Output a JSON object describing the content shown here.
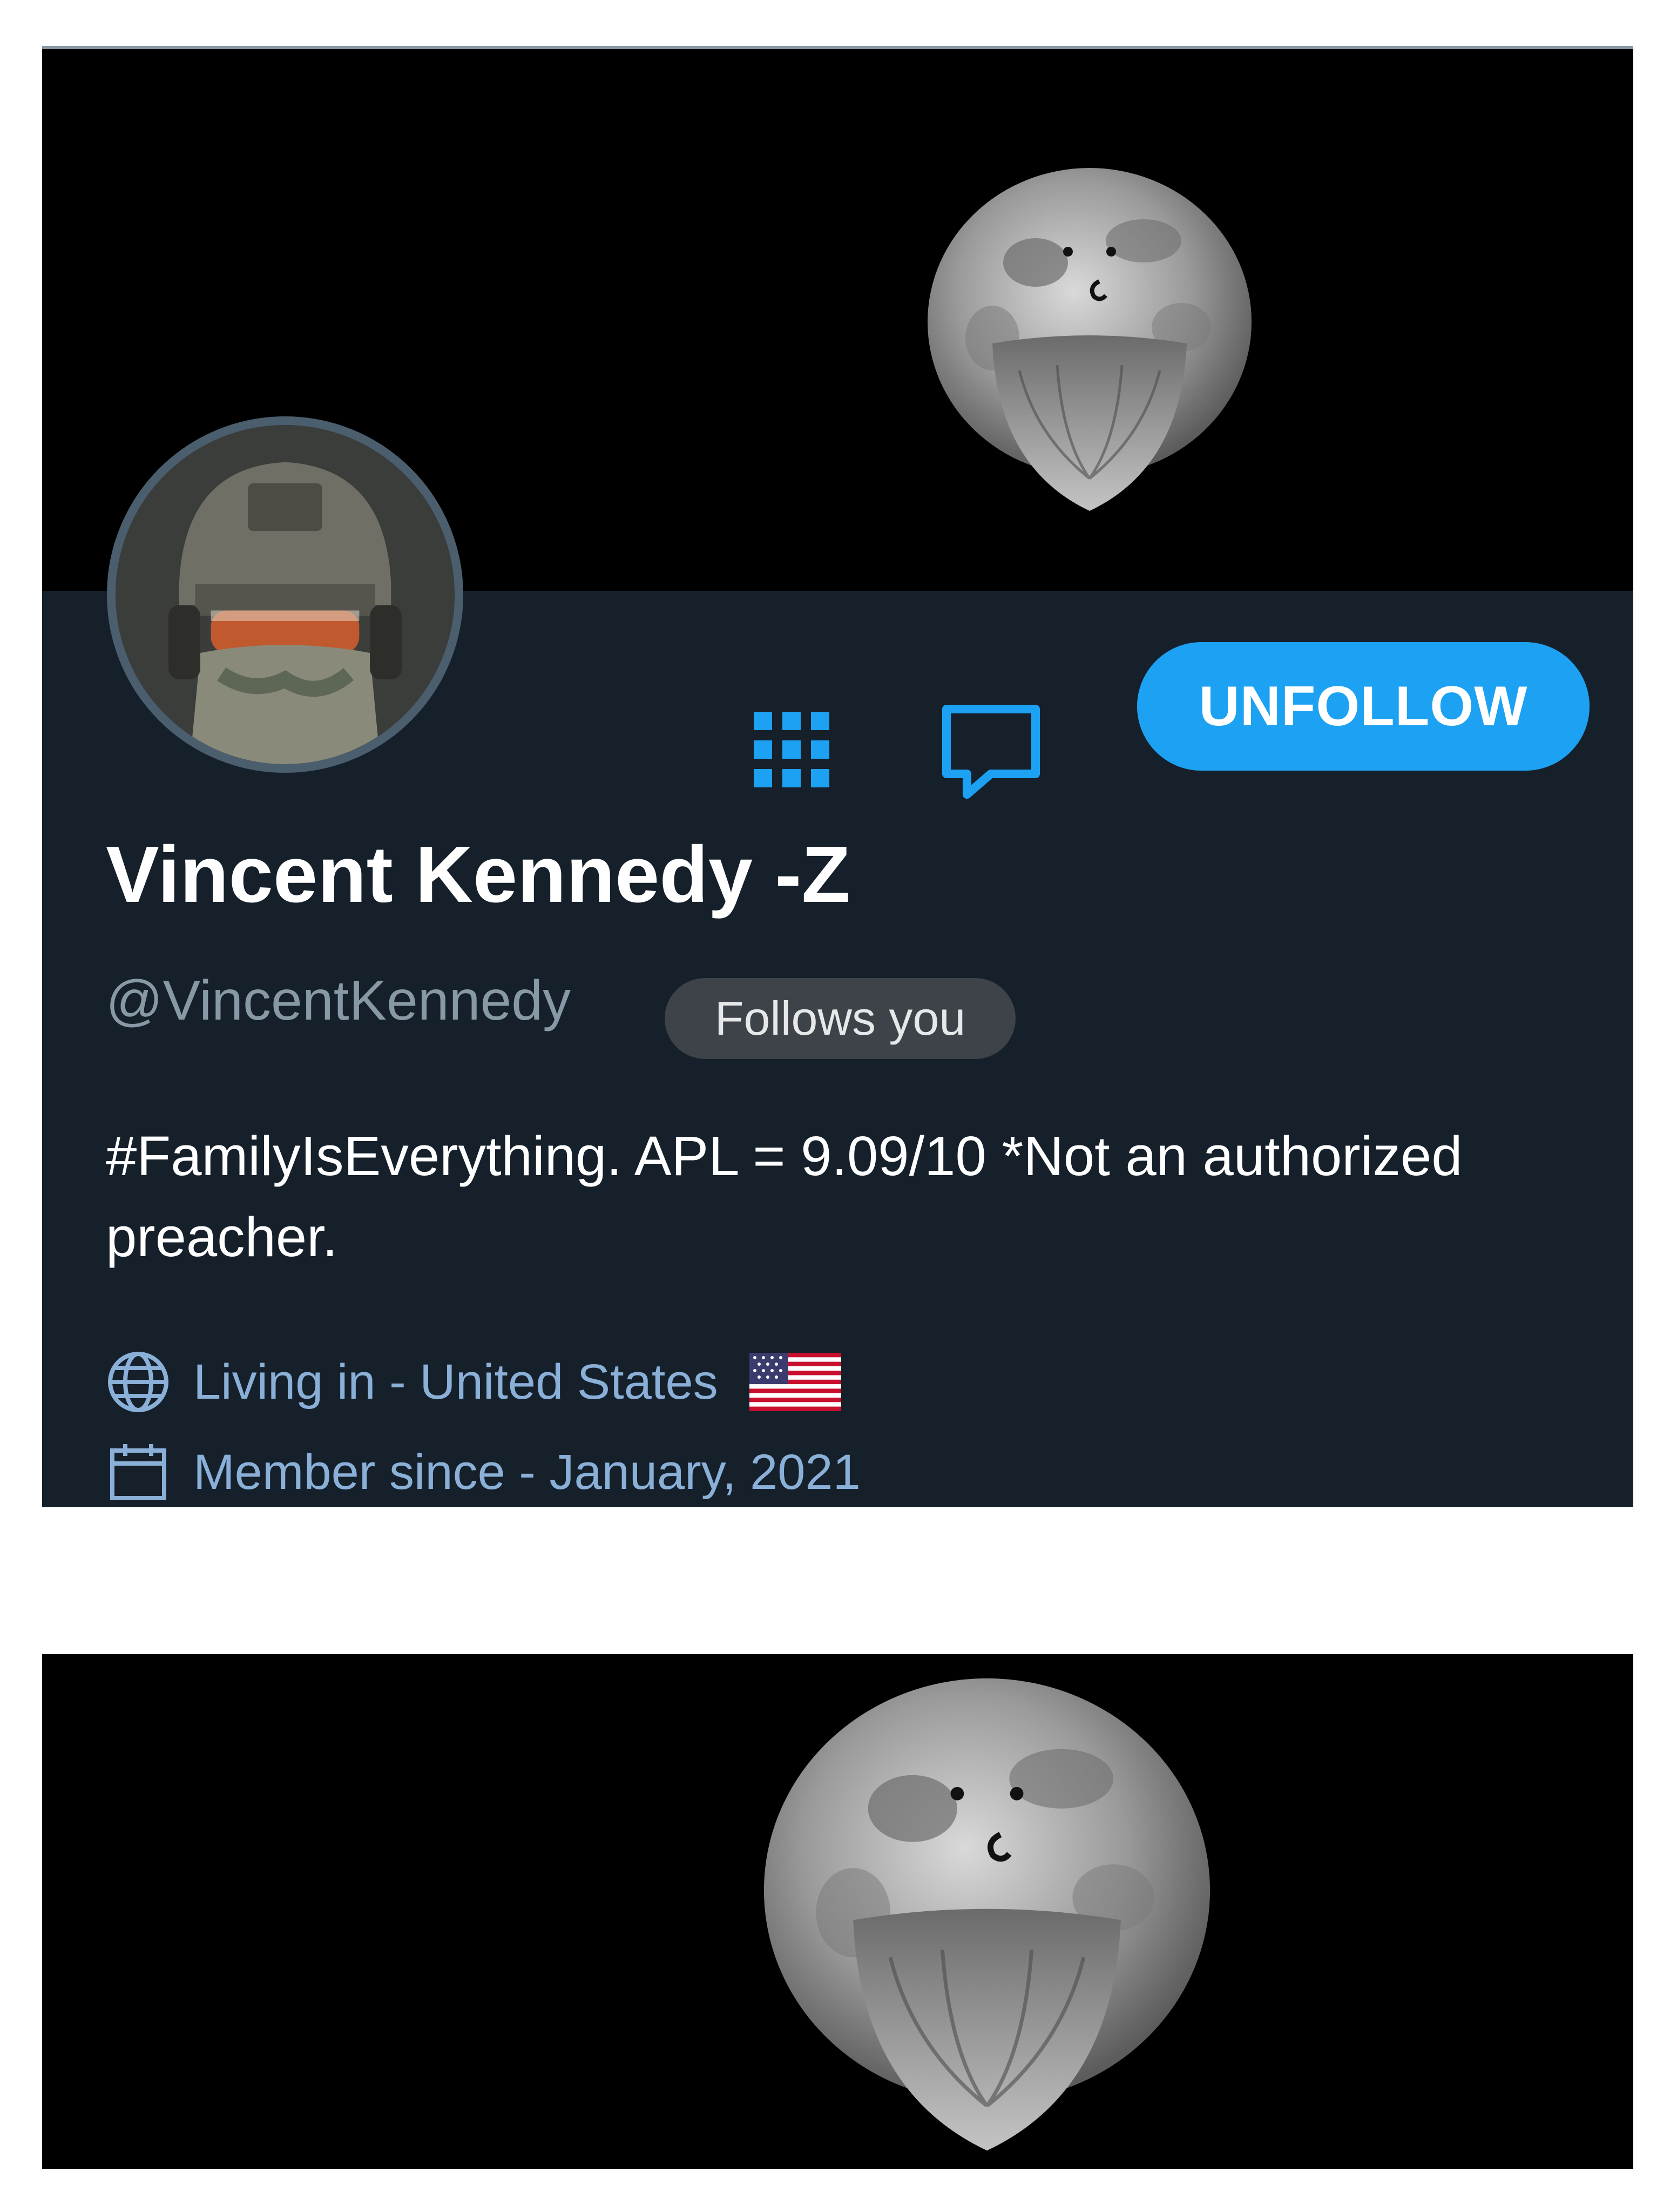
{
  "profile": {
    "display_name": "Vincent Kennedy -Z",
    "handle": "@VincentKennedy",
    "follows_you_badge": "Follows you",
    "bio": "#FamilyIsEverything. APL = 9.09/10 *Not an authorized preacher.",
    "location": "Living in - United States",
    "location_flag": "us-flag-emoji",
    "member_since": "Member since - January, 2021"
  },
  "actions": {
    "unfollow_label": "UNFOLLOW",
    "grid_icon": "grid-icon",
    "message_icon": "message-icon"
  },
  "colors": {
    "accent": "#1da1f2",
    "card_background": "#15202b",
    "banner_background": "#000000",
    "secondary_text": "#8899a6",
    "link_text": "#8ab0d8"
  }
}
